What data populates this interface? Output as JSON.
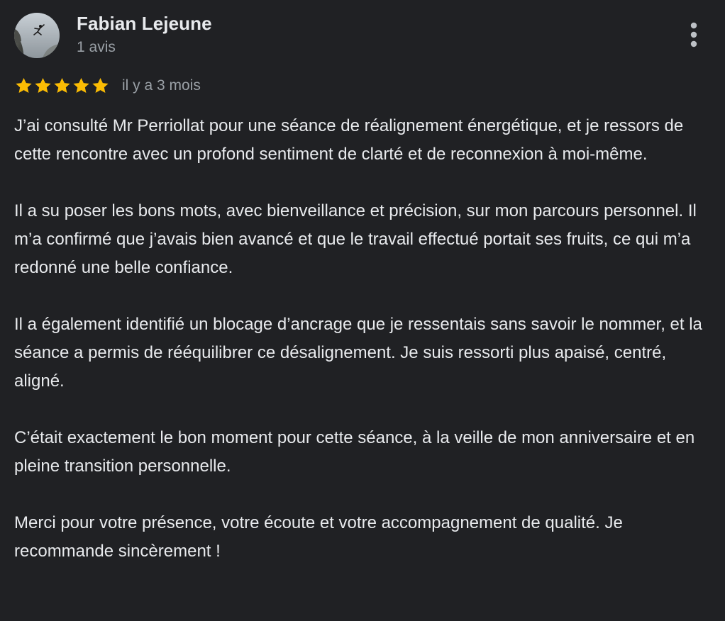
{
  "review": {
    "author": {
      "name": "Fabian Lejeune",
      "meta": "1 avis"
    },
    "rating": {
      "stars": 5,
      "max": 5,
      "star_color": "#fbbc04"
    },
    "date": "il y a 3 mois",
    "menu_icon": "more-vert-icon",
    "paragraphs": [
      "J’ai consulté Mr Perriollat pour une séance de réalignement énergétique, et je ressors de cette rencontre avec un profond sentiment de clarté et de reconnexion à moi-même.",
      "Il a su poser les bons mots, avec bienveillance et précision, sur mon parcours personnel. Il m’a confirmé que j’avais bien avancé et que le travail effectué portait ses fruits, ce qui m’a redonné une belle confiance.",
      "Il a également identifié un blocage d’ancrage que je ressentais sans savoir le nommer, et la séance a permis de rééquilibrer ce désalignement. Je suis ressorti plus apaisé, centré, aligné.",
      "C’était exactement le bon moment pour cette séance, à la veille de mon anniversaire et en pleine transition personnelle.",
      "Merci pour votre présence, votre écoute et votre accompagnement de qualité. Je recommande sincèrement !"
    ]
  },
  "colors": {
    "background": "#202124",
    "text_primary": "#e8eaed",
    "text_secondary": "#9aa0a6",
    "star": "#fbbc04"
  }
}
